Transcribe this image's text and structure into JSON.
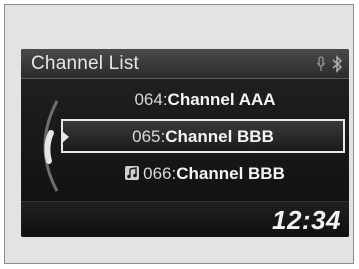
{
  "header": {
    "title": "Channel List",
    "icons": [
      "microphone-icon",
      "bluetooth-icon"
    ]
  },
  "channels": [
    {
      "number": "064:",
      "name": "Channel AAA",
      "selected": false,
      "icon": ""
    },
    {
      "number": "065:",
      "name": "Channel BBB",
      "selected": true,
      "icon": ""
    },
    {
      "number": "066:",
      "name": "Channel BBB",
      "selected": false,
      "icon": "music-note-icon"
    }
  ],
  "footer": {
    "clock": "12:34"
  },
  "colors": {
    "screen_bg": "#161616",
    "text": "#f4f4f4",
    "highlight_border": "#e8e8e8"
  }
}
